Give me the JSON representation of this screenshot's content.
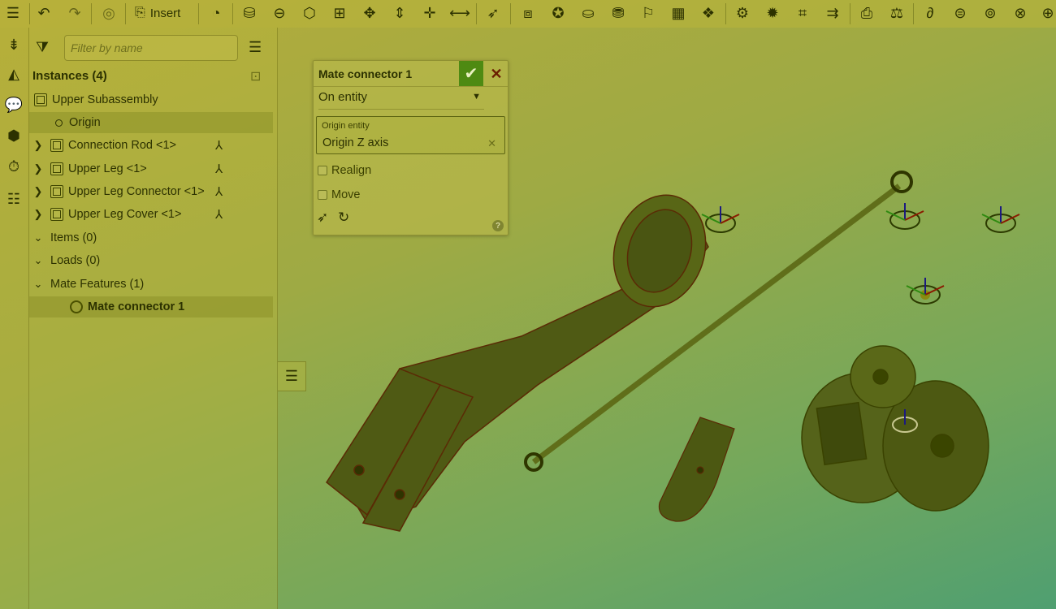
{
  "toolbar": {
    "insert_label": "Insert",
    "icons": [
      "undo-icon",
      "redo-icon",
      "update-icon",
      "insert-icon",
      "mate-connector-icon",
      "cylinder-icon",
      "revolute-icon",
      "slider-icon",
      "planar-icon",
      "ball-icon",
      "pin-slot-icon",
      "fastened-icon",
      "parallel-icon",
      "tangent-icon",
      "group-icon",
      "replicate-icon",
      "pattern-icon",
      "mirror-icon",
      "explode-icon",
      "section-icon",
      "gear-relation-icon",
      "rack-pinion-icon",
      "screw-icon",
      "linear-relation-icon",
      "measure-icon",
      "mass-props-icon",
      "hole-icon",
      "loop-icon",
      "ring-icon",
      "limit-icon",
      "relation-icon"
    ]
  },
  "rail": {
    "icons": [
      "feature-list-icon",
      "insert-part-icon",
      "render-icon",
      "comment-icon",
      "box-icon",
      "animation-icon",
      "bom-icon"
    ]
  },
  "panel": {
    "filter_placeholder": "Filter by name",
    "instances_title": "Instances (4)",
    "subassembly": "Upper Subassembly",
    "origin": "Origin",
    "parts": [
      {
        "name": "Connection Rod <1>"
      },
      {
        "name": "Upper Leg <1>"
      },
      {
        "name": "Upper Leg Connector <1>"
      },
      {
        "name": "Upper Leg Cover <1>"
      }
    ],
    "items": "Items (0)",
    "loads": "Loads (0)",
    "mate_features": "Mate Features (1)",
    "mate_connector": "Mate connector 1"
  },
  "dialog": {
    "title": "Mate connector 1",
    "mode": "On entity",
    "entity_label": "Origin entity",
    "entity_value": "Origin Z axis",
    "realign": "Realign",
    "move": "Move",
    "help": "?"
  },
  "colors": {
    "accent_confirm": "#4e8a12",
    "cancel": "#6a1d00",
    "overlay_top": "#b5ac3a",
    "overlay_bottom": "#4f9f71"
  }
}
